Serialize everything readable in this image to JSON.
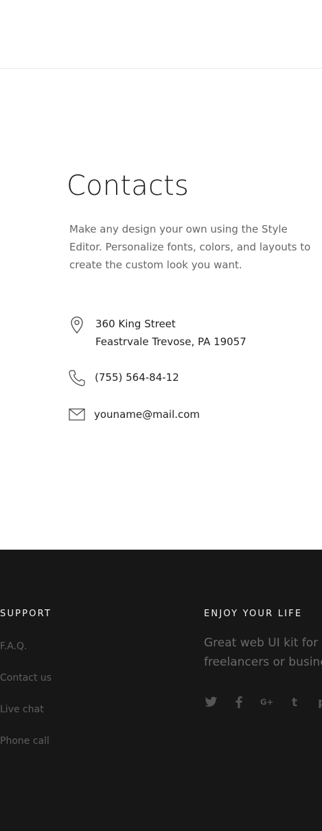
{
  "contacts": {
    "title": "Contacts",
    "description": "Make any design your own using the Style Editor. Personalize fonts, colors, and layouts to create the custom look you want.",
    "address_line1": "360 King Street",
    "address_line2": "Feastrvale Trevose, PA 19057",
    "phone": "(755) 564-84-12",
    "email": "youname@mail.com",
    "icons": [
      "map-pin-icon",
      "phone-icon",
      "mail-icon"
    ]
  },
  "footer": {
    "support_heading": "SUPPORT",
    "support_links": [
      "F.A.Q.",
      "Contact us",
      "Live chat",
      "Phone call"
    ],
    "enjoy_heading": "ENJOY YOUR LIFE",
    "enjoy_line1": "Great web UI kit for",
    "enjoy_line2": "freelancers or busine",
    "social_icons": [
      "twitter-icon",
      "facebook-icon",
      "google-plus-icon",
      "tumblr-icon",
      "pinterest-icon"
    ]
  },
  "colors": {
    "footer_bg": "#171717",
    "text_dark": "#222222",
    "text_muted": "#666666"
  }
}
